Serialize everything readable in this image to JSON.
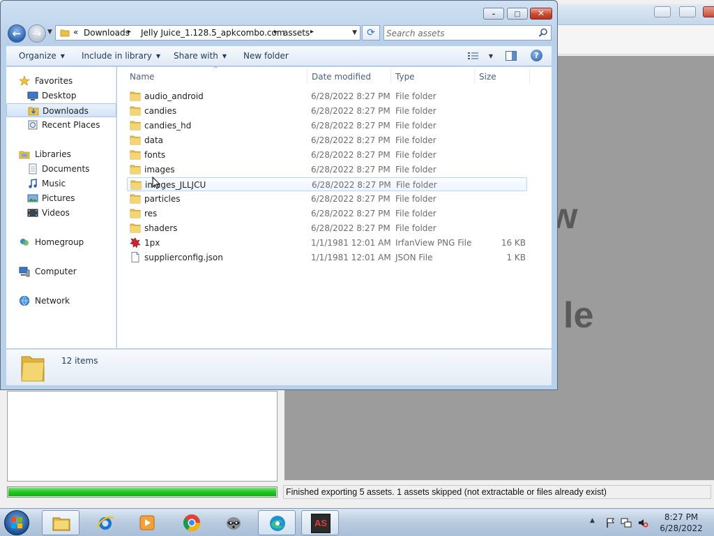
{
  "background_app": {
    "preview_text_1": "w",
    "preview_text_2": "le",
    "progress": 1.0,
    "status_text": "Finished exporting 5 assets. 1 assets skipped (not extractable or files already exist)"
  },
  "explorer": {
    "title_buttons": {
      "minimize": "–",
      "maximize": "□",
      "close": "✕"
    },
    "breadcrumb": {
      "overflow": "«",
      "items": [
        "Downloads",
        "Jelly Juice_1.128.5_apkcombo.com",
        "assets"
      ],
      "separator": "▸"
    },
    "search": {
      "placeholder": "Search assets"
    },
    "commands": {
      "organize": "Organize",
      "include_in_library": "Include in library",
      "share_with": "Share with",
      "new_folder": "New folder",
      "help": "?"
    },
    "nav": {
      "favorites": "Favorites",
      "desktop": "Desktop",
      "downloads": "Downloads",
      "recent_places": "Recent Places",
      "libraries": "Libraries",
      "documents": "Documents",
      "music": "Music",
      "pictures": "Pictures",
      "videos": "Videos",
      "homegroup": "Homegroup",
      "computer": "Computer",
      "network": "Network"
    },
    "columns": {
      "name": "Name",
      "date_modified": "Date modified",
      "type": "Type",
      "size": "Size"
    },
    "files": [
      {
        "name": "audio_android",
        "date": "6/28/2022 8:27 PM",
        "type": "File folder",
        "size": ""
      },
      {
        "name": "candies",
        "date": "6/28/2022 8:27 PM",
        "type": "File folder",
        "size": ""
      },
      {
        "name": "candies_hd",
        "date": "6/28/2022 8:27 PM",
        "type": "File folder",
        "size": ""
      },
      {
        "name": "data",
        "date": "6/28/2022 8:27 PM",
        "type": "File folder",
        "size": ""
      },
      {
        "name": "fonts",
        "date": "6/28/2022 8:27 PM",
        "type": "File folder",
        "size": ""
      },
      {
        "name": "images",
        "date": "6/28/2022 8:27 PM",
        "type": "File folder",
        "size": ""
      },
      {
        "name": "images_JLLJCU",
        "date": "6/28/2022 8:27 PM",
        "type": "File folder",
        "size": ""
      },
      {
        "name": "particles",
        "date": "6/28/2022 8:27 PM",
        "type": "File folder",
        "size": ""
      },
      {
        "name": "res",
        "date": "6/28/2022 8:27 PM",
        "type": "File folder",
        "size": ""
      },
      {
        "name": "shaders",
        "date": "6/28/2022 8:27 PM",
        "type": "File folder",
        "size": ""
      },
      {
        "name": "1px",
        "date": "1/1/1981 12:01 AM",
        "type": "IrfanView PNG File",
        "size": "16 KB"
      },
      {
        "name": "supplierconfig.json",
        "date": "1/1/1981 12:01 AM",
        "type": "JSON File",
        "size": "1 KB"
      }
    ],
    "item_count": "12 items"
  },
  "taskbar": {
    "apps": [
      "windows-explorer",
      "internet-explorer",
      "media-player",
      "chrome",
      "raccoon-app",
      "edge",
      "asset-studio"
    ],
    "asset_studio_label": "AS",
    "time": "8:27 PM",
    "date": "6/28/2022"
  },
  "colors": {
    "progress_green": "#22c322",
    "folder_yellow": "#e8c04a",
    "link_blue": "#1e395b"
  }
}
